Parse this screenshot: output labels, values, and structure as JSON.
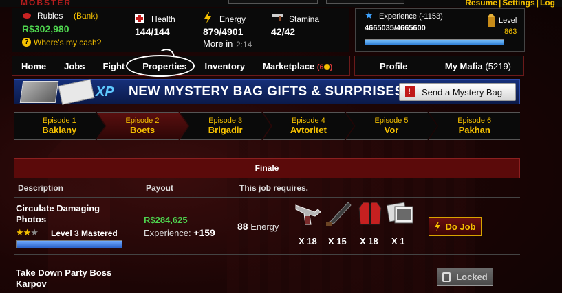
{
  "header": {
    "logo_fragment": "MOBSTER",
    "top_links": [
      "Resume",
      "Settings",
      "Log"
    ]
  },
  "stats": {
    "rubles_label": "Rubles",
    "bank_label": "(Bank)",
    "rubles_value": "R$302,980",
    "cash_help": "Where's my cash?",
    "health_label": "Health",
    "health_value": "144/144",
    "energy_label": "Energy",
    "energy_value": "879/4901",
    "more_in_label": "More in",
    "more_in_time": "2:14",
    "stamina_label": "Stamina",
    "stamina_value": "42/42",
    "experience_label": "Experience (-1153)",
    "experience_value": "4665035/4665600",
    "experience_progress": 0.999,
    "level_label": "Level",
    "level_value": "863"
  },
  "nav": {
    "items": [
      "Home",
      "Jobs",
      "Fight",
      "Properties",
      "Inventory",
      "Marketplace"
    ],
    "marketplace_count": "6",
    "profile": "Profile",
    "my_mafia": "My Mafia",
    "my_mafia_count": "(5219)"
  },
  "banner": {
    "xp_tag": "XP",
    "title": "NEW MYSTERY BAG GIFTS & SURPRISES!",
    "button": "Send a Mystery Bag"
  },
  "episodes": [
    {
      "num": "Episode 1",
      "name": "Baklany"
    },
    {
      "num": "Episode 2",
      "name": "Boets"
    },
    {
      "num": "Episode 3",
      "name": "Brigadir"
    },
    {
      "num": "Episode 4",
      "name": "Avtoritet"
    },
    {
      "num": "Episode 5",
      "name": "Vor"
    },
    {
      "num": "Episode 6",
      "name": "Pakhan"
    }
  ],
  "finale": "Finale",
  "table": {
    "headers": [
      "Description",
      "Payout",
      "This job requires."
    ],
    "jobs": [
      {
        "name_line1": "Circulate Damaging",
        "name_line2": "Photos",
        "mastery": "Level 3 Mastered",
        "mastery_progress": 1.0,
        "payout": "R$284,625",
        "experience_label": "Experience:",
        "experience_value": "+159",
        "energy_value": "88",
        "energy_label": "Energy",
        "requirements": [
          {
            "icon": "pistol-icon",
            "count": "X 18"
          },
          {
            "icon": "machete-icon",
            "count": "X 15"
          },
          {
            "icon": "jacket-icon",
            "count": "X 18"
          },
          {
            "icon": "photos-icon",
            "count": "X 1"
          }
        ],
        "action": "Do Job"
      },
      {
        "name_line1": "Take Down Party Boss",
        "name_line2": "Karpov",
        "action": "Locked"
      }
    ]
  },
  "colors": {
    "accent_yellow": "#f5c000",
    "money_green": "#4ed34e",
    "finale_red": "#5b0a0a",
    "banner_blue": "#16307a"
  }
}
